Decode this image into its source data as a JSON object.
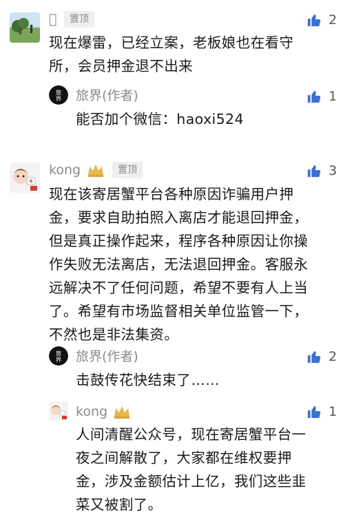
{
  "comments": [
    {
      "name": "\u0000",
      "pinned_label": "置顶",
      "likes": "2",
      "text": "现在爆雷，已经立案，老板娘也在看守\n所，会员押金退不出来",
      "reply": {
        "name": "旅界(作者)",
        "likes": "1",
        "text": "能否加个微信：haoxi524"
      }
    },
    {
      "name": "kong",
      "pinned_label": "置顶",
      "likes": "3",
      "text": "现在该寄居蟹平台各种原因诈骗用户押\n金，要求自助拍照入离店才能退回押金，\n但是真正操作起来，程序各种原因让你操\n作失败无法离店，无法退回押金。客服永\n远解决不了任何问题，希望不要有人上当\n了。希望有市场监督相关单位监管一下，\n不然也是非法集资。",
      "replies": [
        {
          "name": "旅界(作者)",
          "likes": "2",
          "text": "击鼓传花快结束了……"
        },
        {
          "name": "kong",
          "likes": "1",
          "text": "人间清醒公众号，现在寄居蟹平台一\n夜之间解散了，大家都在维权要押\n金，涉及金额估计上亿，我们这些韭\n菜又被割了。"
        }
      ]
    }
  ],
  "colors": {
    "like_blue": "#3b6fd1",
    "name_gray": "#8c8c8c",
    "crown_gold": "#e7b84b"
  },
  "icons": {
    "like": "thumbs-up-icon",
    "crown": "crown-icon"
  }
}
